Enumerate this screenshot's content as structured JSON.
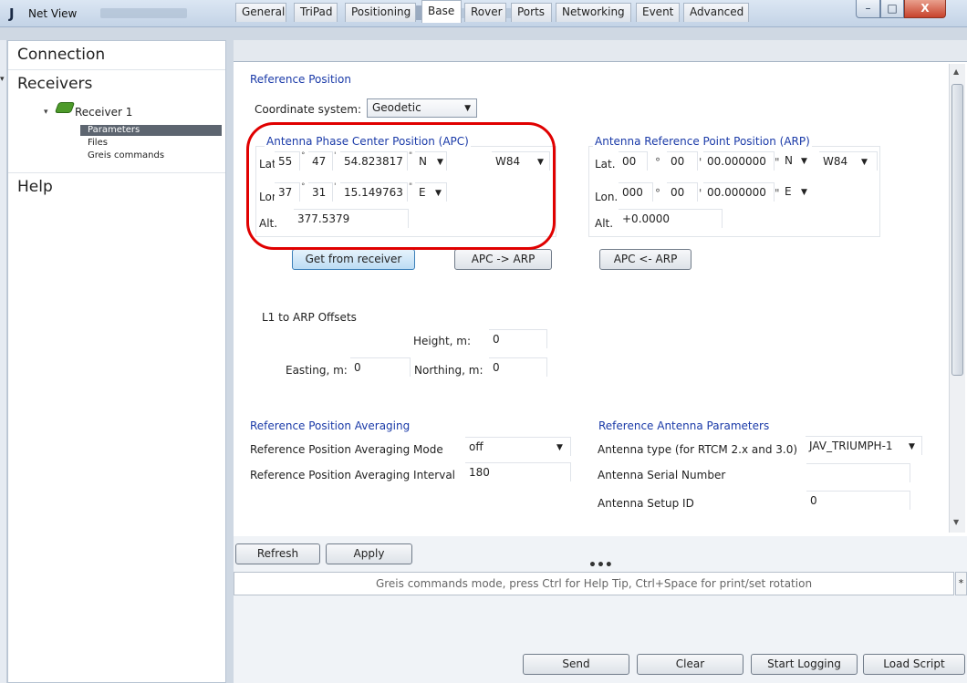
{
  "window": {
    "title": "Net View",
    "logo": "J",
    "controls": [
      "–",
      "□",
      "X"
    ]
  },
  "nav": {
    "connection": "Connection",
    "receivers": "Receivers",
    "receiver_item": "Receiver 1",
    "sub_items": [
      "Parameters",
      "Files",
      "Greis commands"
    ],
    "help": "Help"
  },
  "tabs": [
    "General",
    "TriPad",
    "Positioning",
    "Base",
    "Rover",
    "Ports",
    "Networking",
    "Event",
    "Advanced"
  ],
  "active_tab": "Base",
  "ref_position": {
    "title": "Reference Position",
    "coord_label": "Coordinate system:",
    "coord_value": "Geodetic",
    "apc": {
      "title": "Antenna Phase Center Position (APC)",
      "lat_label": "Lat.",
      "lat_deg": "55",
      "lat_min": "47",
      "lat_sec": "54.823817",
      "lat_hem": "N",
      "datum": "W84",
      "lon_label": "Lon.",
      "lon_deg": "37",
      "lon_min": "31",
      "lon_sec": "15.149763",
      "lon_hem": "E",
      "alt_label": "Alt.",
      "alt": "377.5379"
    },
    "arp": {
      "title": "Antenna Reference Point Position (ARP)",
      "lat_label": "Lat.",
      "lat_deg": "00",
      "lat_min": "00",
      "lat_sec": "00.000000",
      "lat_hem": "N",
      "datum": "W84",
      "lon_label": "Lon.",
      "lon_deg": "000",
      "lon_min": "00",
      "lon_sec": "00.000000",
      "lon_hem": "E",
      "alt_label": "Alt.",
      "alt": "+0.0000"
    },
    "get_btn": "Get from receiver",
    "apc_arp_btn": "APC -> ARP",
    "arp_apc_btn": "APC <- ARP"
  },
  "offsets": {
    "title": "L1 to ARP Offsets",
    "height_label": "Height, m:",
    "height": "0",
    "easting_label": "Easting, m:",
    "easting": "0",
    "northing_label": "Northing, m:",
    "northing": "0"
  },
  "averaging": {
    "title": "Reference Position Averaging",
    "mode_label": "Reference Position Averaging Mode",
    "mode": "off",
    "interval_label": "Reference Position Averaging Interval",
    "interval": "180"
  },
  "antenna": {
    "title": "Reference Antenna Parameters",
    "type_label": "Antenna type (for RTCM 2.x and 3.0)",
    "type": "JAV_TRIUMPH-1",
    "serial_label": "Antenna Serial Number",
    "serial": "",
    "setup_label": "Antenna Setup ID",
    "setup": "0"
  },
  "actions": {
    "refresh": "Refresh",
    "apply": "Apply"
  },
  "cmd": {
    "placeholder": "Greis commands mode, press Ctrl for Help Tip, Ctrl+Space for print/set rotation",
    "side": "*",
    "send": "Send",
    "clear": "Clear",
    "start_logging": "Start Logging",
    "load_script": "Load Script"
  }
}
